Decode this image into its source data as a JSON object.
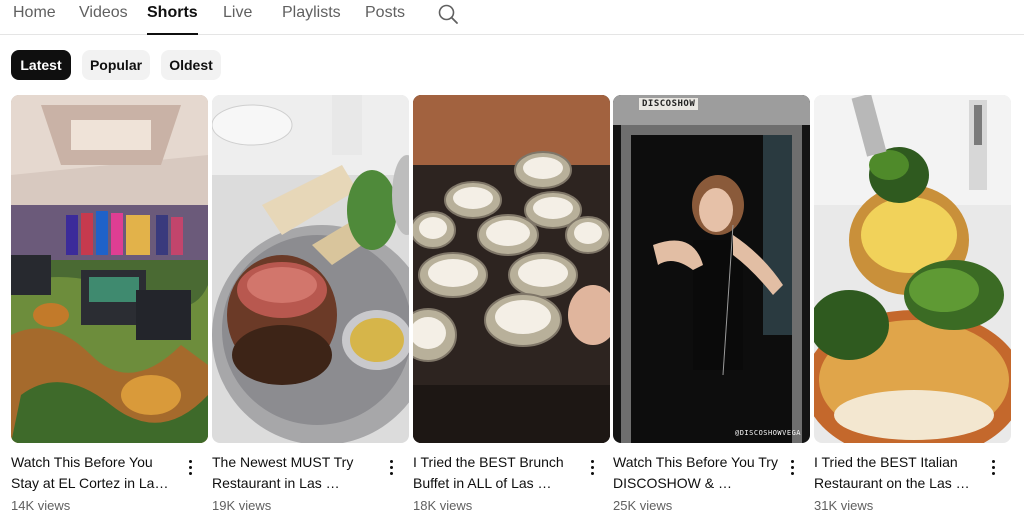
{
  "tabs": [
    {
      "label": "Home"
    },
    {
      "label": "Videos"
    },
    {
      "label": "Shorts"
    },
    {
      "label": "Live"
    },
    {
      "label": "Playlists"
    },
    {
      "label": "Posts"
    }
  ],
  "active_tab": "Shorts",
  "icons": {
    "search": "search-icon",
    "more": "more-vert-icon"
  },
  "filters": [
    {
      "label": "Latest",
      "selected": true
    },
    {
      "label": "Popular",
      "selected": false
    },
    {
      "label": "Oldest",
      "selected": false
    }
  ],
  "shorts": [
    {
      "title": "Watch This Before You Stay at EL Cortez in Las Vegas",
      "title_display": "Watch This Before You Stay at EL Cortez in La…",
      "views": "14K views"
    },
    {
      "title": "The Newest MUST Try Restaurant in Las …",
      "title_display": "The Newest MUST Try Restaurant in Las …",
      "views": "19K views"
    },
    {
      "title": "I Tried the BEST Brunch Buffet in ALL of Las …",
      "title_display": "I Tried the BEST Brunch Buffet in ALL of Las …",
      "views": "18K views",
      "thumb_text": ""
    },
    {
      "title": "Watch This Before You Try DISCOSHOW & …",
      "title_display": "Watch This Before You Try DISCOSHOW & …",
      "views": "25K views",
      "sign_text": "DISCOSHOW",
      "watermark": "@DISCOSHOWVEGA"
    },
    {
      "title": "I Tried the BEST Italian Restaurant on the Las …",
      "title_display": "I Tried the BEST Italian Restaurant on the Las …",
      "views": "31K views"
    }
  ],
  "colors": {
    "accent": "#0f0f0f",
    "chip_bg": "#f2f2f2",
    "secondary_text": "#606060"
  }
}
